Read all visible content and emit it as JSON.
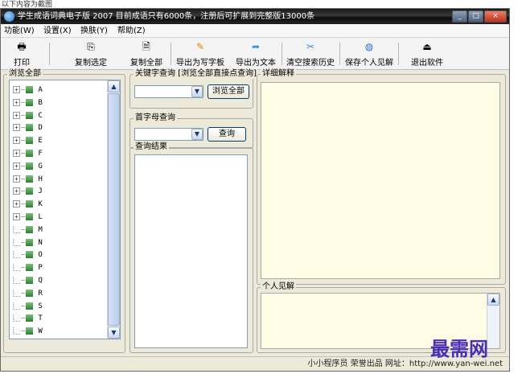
{
  "page_caption": "以下内容为截图",
  "window": {
    "title": "学生成语词典电子版 2007 目前成语只有6000条，注册后可扩展到完整版13000条",
    "controls": {
      "minimize": "_",
      "maximize": "□",
      "close": "×"
    }
  },
  "menubar": {
    "items": [
      {
        "label": "功能(W)"
      },
      {
        "label": "设置(X)"
      },
      {
        "label": "换肤(Y)"
      },
      {
        "label": "帮助(Z)"
      }
    ]
  },
  "toolbar": {
    "print": "打印",
    "copy_selected": "复制选定",
    "copy_all": "复制全部",
    "export_wordpad": "导出为写字板",
    "export_text": "导出为文本",
    "clear_history": "清空搜索历史",
    "save_opinion": "保存个人见解",
    "exit": "退出软件"
  },
  "browse_panel": {
    "label": "浏览全部",
    "items": [
      {
        "label": "A",
        "expandable": true
      },
      {
        "label": "B",
        "expandable": true
      },
      {
        "label": "C",
        "expandable": true
      },
      {
        "label": "D",
        "expandable": true
      },
      {
        "label": "E",
        "expandable": true
      },
      {
        "label": "F",
        "expandable": true
      },
      {
        "label": "G",
        "expandable": true
      },
      {
        "label": "H",
        "expandable": true
      },
      {
        "label": "J",
        "expandable": true
      },
      {
        "label": "K",
        "expandable": true
      },
      {
        "label": "L",
        "expandable": true
      },
      {
        "label": "M",
        "expandable": false
      },
      {
        "label": "N",
        "expandable": false
      },
      {
        "label": "O",
        "expandable": false
      },
      {
        "label": "P",
        "expandable": false
      },
      {
        "label": "Q",
        "expandable": false
      },
      {
        "label": "R",
        "expandable": false
      },
      {
        "label": "S",
        "expandable": false
      },
      {
        "label": "T",
        "expandable": false
      },
      {
        "label": "W",
        "expandable": false
      }
    ]
  },
  "keyword_search": {
    "label": "关键字查询 [浏览全部直接点查询]",
    "value": "",
    "button": "浏览全部"
  },
  "initial_search": {
    "label": "首字母查询",
    "value": "",
    "button": "查询"
  },
  "results": {
    "label": "查询结果"
  },
  "detail": {
    "label": "详细解释"
  },
  "opinion": {
    "label": "个人见解"
  },
  "status": "小小程序员  荣誉出品  网址：http://www.yan-wei.net",
  "watermark": "最需网",
  "colors": {
    "detail_bg": "#fffce6",
    "window_bg": "#ece9d8",
    "watermark": "#4a2fb5"
  }
}
